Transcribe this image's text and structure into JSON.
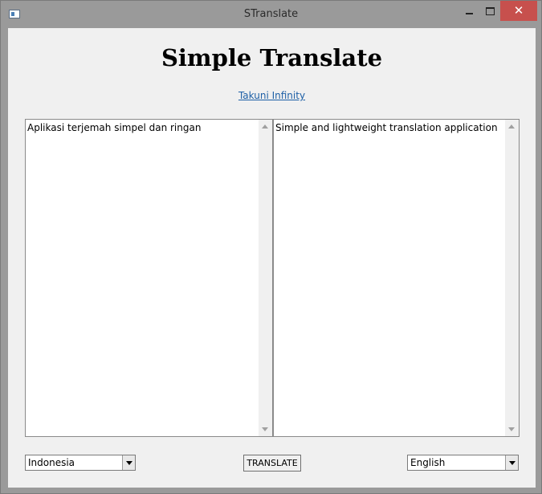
{
  "window": {
    "title": "STranslate",
    "close_glyph": "✕"
  },
  "header": {
    "title": "Simple Translate",
    "link_text": "Takuni Infinity"
  },
  "source": {
    "text": "Aplikasi terjemah simpel dan ringan",
    "language": "Indonesia"
  },
  "target": {
    "text": "Simple and lightweight translation application",
    "language": "English"
  },
  "actions": {
    "translate_label": "TRANSLATE"
  },
  "icons": {
    "app": "app-window-icon",
    "minimize": "minimize-icon",
    "maximize": "maximize-icon",
    "close": "close-icon",
    "dropdown": "chevron-down-icon",
    "scroll_up": "scroll-up-arrow-icon",
    "scroll_down": "scroll-down-arrow-icon"
  },
  "colors": {
    "titlebar": "#9a9a9a",
    "close_button": "#c7504d",
    "client_bg": "#f0f0f0",
    "link": "#1d5fa6"
  }
}
